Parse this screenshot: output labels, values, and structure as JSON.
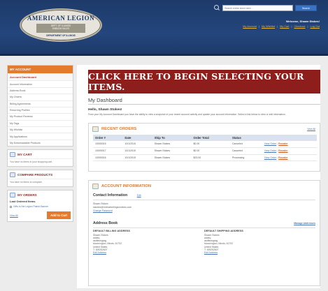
{
  "header": {
    "logo": {
      "top": "AMERICAN LEGION",
      "mid_line1": "DEPT. OF ILLINOIS",
      "mid_line2": "EMBLEM SALES",
      "bottom": "DEPARTMENT OF ILLINOIS"
    },
    "search": {
      "placeholder": "Search entire store here...",
      "button_label": "Search"
    },
    "welcome": "Welcome, Shawn Stokes!",
    "links": [
      "My Account",
      "My Wishlist",
      "My Cart",
      "Checkout",
      "Log Out"
    ],
    "colors": {
      "bar": "#24467d",
      "links": "#e9b43a"
    }
  },
  "sidebar": {
    "account_title": "MY ACCOUNT",
    "account_items": [
      "Account Dashboard",
      "Account Information",
      "Address Book",
      "My Orders",
      "Billing Agreements",
      "Recurring Profiles",
      "My Product Reviews",
      "My Tags",
      "My Wishlist",
      "My Applications",
      "My Downloadable Products"
    ],
    "cart": {
      "title": "MY CART",
      "text": "You have no items in your shopping cart."
    },
    "compare": {
      "title": "COMPARE PRODUCTS",
      "text": "You have no items to compare."
    },
    "orders": {
      "title": "MY ORDERS",
      "subtitle": "Last Ordered Items",
      "item": "Gifts to the Legion Patriot Banner",
      "view_all": "View All",
      "add_to_cart": "Add to Cart"
    }
  },
  "main": {
    "banner": "CLICK HERE TO BEGIN SELECTING YOUR ITEMS.",
    "dashboard_title": "My Dashboard",
    "hello": "Hello, Shawn Stokes!",
    "intro": "From your My Account Dashboard you have the ability to view a snapshot of your recent account activity and update your account information. Select a link below to view or edit information.",
    "recent_orders": {
      "title": "RECENT ORDERS",
      "view_all": "View All",
      "columns": [
        "Order #",
        "Date",
        "Ship To",
        "Order Total",
        "Status",
        ""
      ],
      "rows": [
        {
          "order": "10000015",
          "date": "10/1/2015",
          "ship_to": "Shawn Stokes",
          "total": "$0.00",
          "status": "Canceled",
          "view": "View Order",
          "reorder": "Reorder"
        },
        {
          "order": "10000017",
          "date": "10/1/2015",
          "ship_to": "Shawn Stokes",
          "total": "$0.00",
          "status": "Canceled",
          "view": "View Order",
          "reorder": "Reorder"
        },
        {
          "order": "10000016",
          "date": "10/1/2015",
          "ship_to": "Shawn Stokes",
          "total": "$23.00",
          "status": "Processing",
          "view": "View Order",
          "reorder": "Reorder"
        }
      ]
    },
    "account_info": {
      "title": "ACCOUNT INFORMATION",
      "contact_title": "Contact Information",
      "edit": "Edit",
      "name": "Shawn Stokes",
      "email": "sstokes@mrlmarketingsolutions.com",
      "change_password": "Change Password"
    },
    "address_book": {
      "title": "Address Book",
      "manage": "Manage Addresses",
      "billing": {
        "heading": "DEFAULT BILLING ADDRESS",
        "lines": [
          "Shawn Stokes",
          "addeq",
          "asdfasegsag",
          "bloomington, Illinois, 61702",
          "United States",
          "T: 309252607"
        ],
        "edit": "Edit Address"
      },
      "shipping": {
        "heading": "DEFAULT SHIPPING ADDRESS",
        "lines": [
          "Shawn Stokes",
          "addeq",
          "asdfasegsag",
          "bloomington, Illinois, 61702",
          "United States",
          "T: 309252607"
        ],
        "edit": "Edit Address"
      }
    }
  }
}
